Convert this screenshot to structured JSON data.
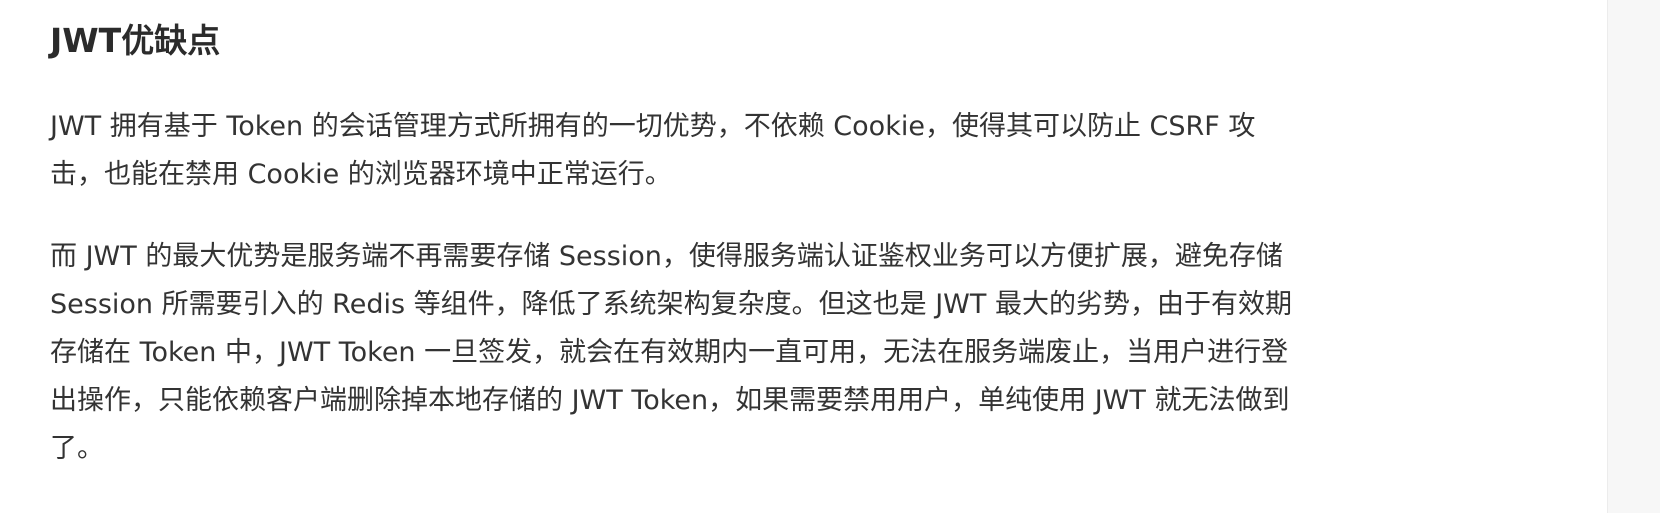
{
  "article": {
    "heading": "JWT优缺点",
    "paragraphs": [
      {
        "lines": [
          "JWT 拥有基于 Token 的会话管理方式所拥有的一切优势，不依赖 Cookie，使得其可以防止 CSRF 攻",
          "击，也能在禁用 Cookie 的浏览器环境中正常运行。"
        ]
      },
      {
        "lines": [
          "而 JWT 的最大优势是服务端不再需要存储 Session，使得服务端认证鉴权业务可以方便扩展，避免存储",
          "Session 所需要引入的 Redis 等组件，降低了系统架构复杂度。但这也是 JWT 最大的劣势，由于有效期",
          "存储在 Token 中，JWT Token 一旦签发，就会在有效期内一直可用，无法在服务端废止，当用户进行登",
          "出操作，只能依赖客户端删除掉本地存储的 JWT Token，如果需要禁用用户，单纯使用 JWT 就无法做到",
          "了。"
        ]
      }
    ]
  }
}
